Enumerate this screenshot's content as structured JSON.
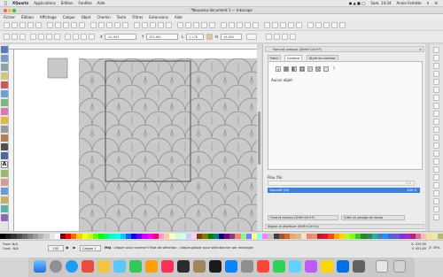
{
  "mac_menu": {
    "app": "XQuartz",
    "items": [
      "Applications",
      "Édition",
      "Fenêtre",
      "Aide"
    ],
    "clock": "Sam. 14:34",
    "user": "Annie Ferlatte"
  },
  "window": {
    "title": "*Nouveau document 1 — Inkscape"
  },
  "menu": {
    "items": [
      "Fichier",
      "Édition",
      "Affichage",
      "Calque",
      "Objet",
      "Chemin",
      "Texte",
      "Filtres",
      "Extensions",
      "Aide"
    ]
  },
  "tool_controls": {
    "x": "-94,993",
    "y": "355,681",
    "w": "1,278",
    "h": "18,800"
  },
  "panel": {
    "title": "Fond et contour (Shift+Ctrl+F)",
    "tabs": [
      "Fond",
      "Contour",
      "Style du contour"
    ],
    "active_tab": "Contour",
    "unset_label": "?",
    "no_object": "Aucun objet",
    "blur_label": "Flou (%)",
    "blur_value": "0,0",
    "opacity_label": "Opacité (%)",
    "opacity_value": "100,0",
    "bottom_tab": "Fond et contour (Shift+Ctrl+F)",
    "bottom_tab2": "Créer un pavage de clones",
    "align_tab": "Aligner et distribuer (Shift+Ctrl+A)"
  },
  "status": {
    "fill_label": "Fond",
    "fill_value": "N/A",
    "stroke_label": "Cont.",
    "stroke_value": "N/A",
    "layer": "Calque 1",
    "message_bold": "Maj",
    "message": " : cliquer pour inverser l'état de sélection ; cliquer-glisser pour sélectionner par rectangle",
    "coords_x": "X: 225,90",
    "coords_y": "Y: 451,65",
    "zoom": "Z: 35%"
  },
  "colors": {
    "selection_blue": "#3d80df",
    "pattern_bg": "#c9c9c9",
    "pattern_line": "#8a8a8a"
  },
  "palette_colors": [
    "#000000",
    "#1a1a1a",
    "#333333",
    "#4d4d4d",
    "#666666",
    "#808080",
    "#999999",
    "#b3b3b3",
    "#cccccc",
    "#e6e6e6",
    "#ffffff",
    "#800000",
    "#ff0000",
    "#ff6600",
    "#ffcc00",
    "#ffff00",
    "#ccff00",
    "#66ff00",
    "#00ff00",
    "#00ff66",
    "#00ffcc",
    "#00ffff",
    "#00ccff",
    "#0066ff",
    "#0000ff",
    "#6600ff",
    "#cc00ff",
    "#ff00ff",
    "#ff0066",
    "#ff99cc",
    "#ffcc99",
    "#ffffcc",
    "#ccffcc",
    "#ccffff",
    "#ccccff",
    "#ffccff",
    "#804000",
    "#808000",
    "#008000",
    "#008080",
    "#000080",
    "#800080",
    "#804080",
    "#ff8080",
    "#80ff80",
    "#8080ff",
    "#ffff80",
    "#80ffff",
    "#ff80ff",
    "#c0c0c0",
    "#404040",
    "#a0522d",
    "#d2691e",
    "#f4a460",
    "#deb887",
    "#ffe4c4",
    "#fa8072",
    "#e9967a",
    "#b22222",
    "#dc143c",
    "#ff4500",
    "#ffa500",
    "#ffd700",
    "#adff2f",
    "#7fff00",
    "#32cd32",
    "#228b22",
    "#2e8b57",
    "#20b2aa",
    "#4682b4",
    "#1e90ff",
    "#4169e1",
    "#6a5acd",
    "#8a2be2",
    "#9932cc",
    "#c71585",
    "#db7093",
    "#ffb6c1",
    "#f0e68c",
    "#eee8aa",
    "#bdb76b"
  ]
}
